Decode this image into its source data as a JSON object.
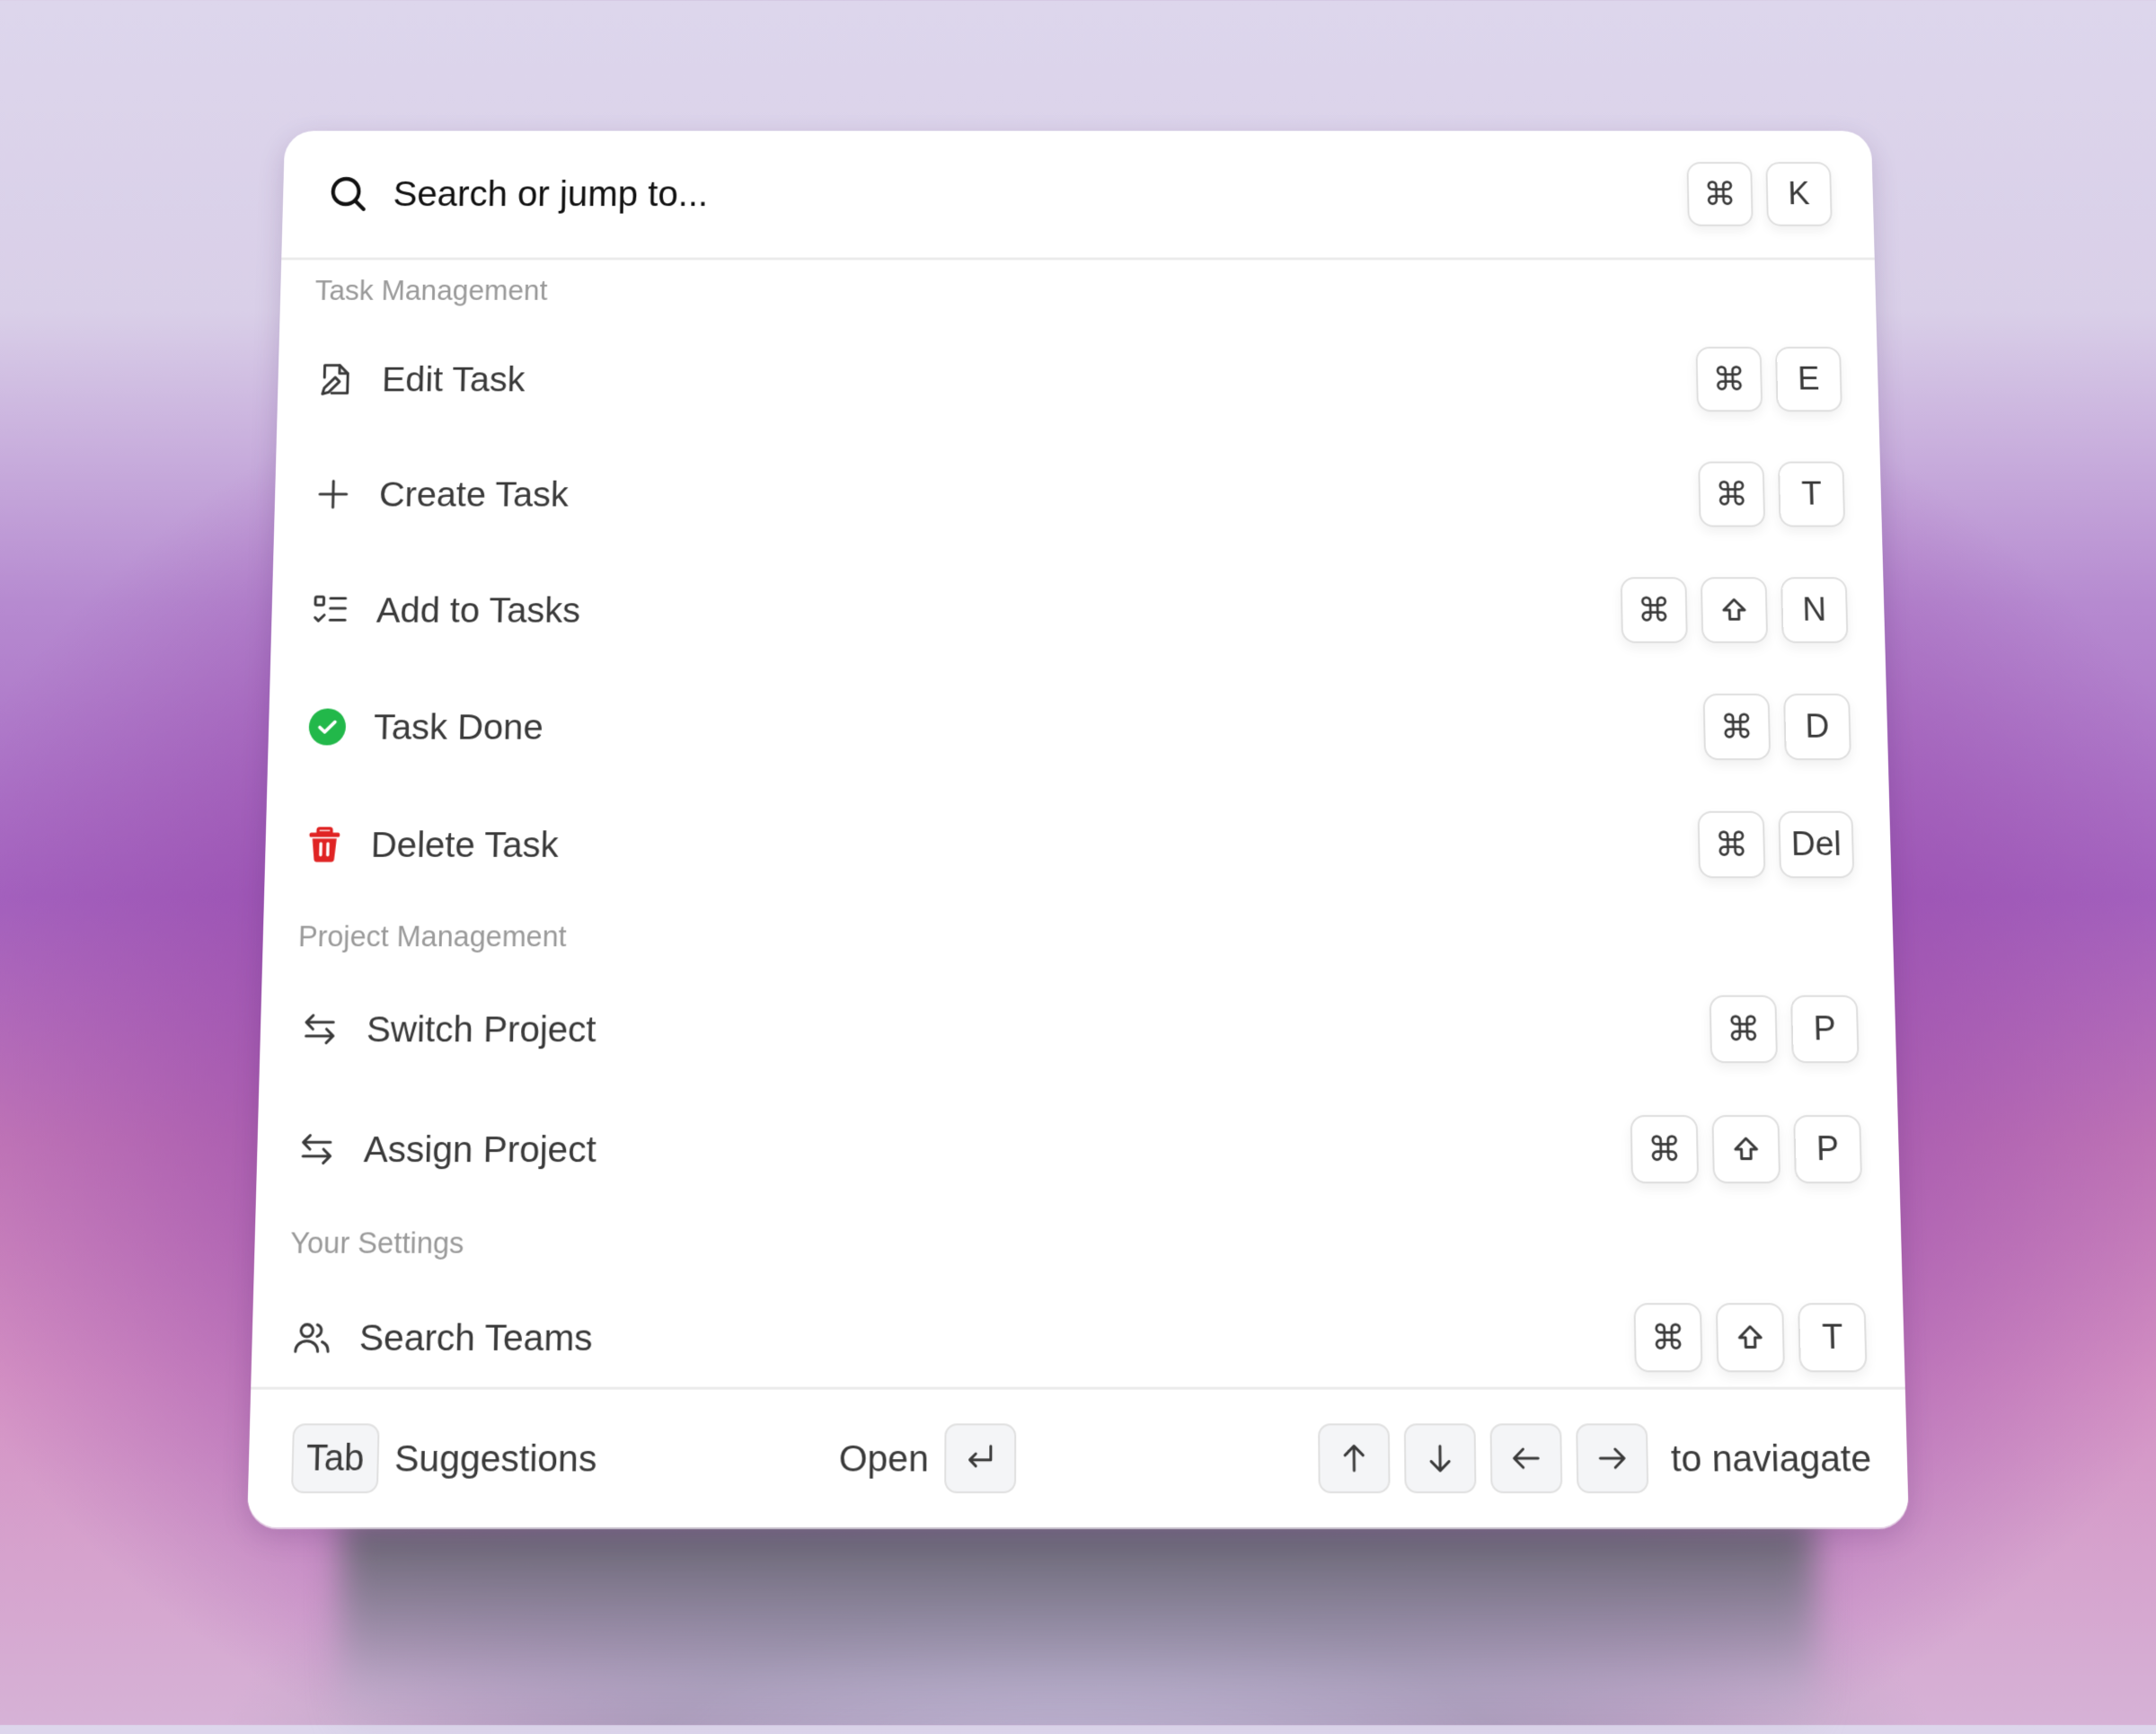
{
  "search": {
    "placeholder": "Search or jump to...",
    "icon": "search-icon",
    "shortcut": [
      "⌘",
      "K"
    ]
  },
  "sections": [
    {
      "label": "Task Management",
      "items": [
        {
          "label": "Edit Task",
          "icon": "file-edit-icon",
          "keys": [
            "⌘",
            "E"
          ]
        },
        {
          "label": "Create Task",
          "icon": "plus-icon",
          "keys": [
            "⌘",
            "T"
          ]
        },
        {
          "label": "Add to Tasks",
          "icon": "checklist-icon",
          "keys": [
            "⌘",
            "⇧",
            "N"
          ]
        },
        {
          "label": "Task Done",
          "icon": "check-circle-icon",
          "keys": [
            "⌘",
            "D"
          ]
        },
        {
          "label": "Delete Task",
          "icon": "trash-icon",
          "keys": [
            "⌘",
            "Del"
          ]
        }
      ]
    },
    {
      "label": "Project Management",
      "items": [
        {
          "label": "Switch Project",
          "icon": "arrows-swap-icon",
          "keys": [
            "⌘",
            "P"
          ]
        },
        {
          "label": "Assign Project",
          "icon": "arrows-swap-icon",
          "keys": [
            "⌘",
            "⇧",
            "P"
          ]
        }
      ]
    },
    {
      "label": "Your Settings",
      "items": [
        {
          "label": "Search Teams",
          "icon": "users-icon",
          "keys": [
            "⌘",
            "⇧",
            "T"
          ]
        }
      ]
    }
  ],
  "footer": {
    "tab_key": "Tab",
    "suggestions_label": "Suggestions",
    "open_label": "Open",
    "enter_key": "↵",
    "nav_keys": [
      "↑",
      "↓",
      "←",
      "→"
    ],
    "navigate_label": "to naviagate"
  },
  "colors": {
    "success": "#22b84a",
    "danger": "#e02424",
    "text": "#3a3a3a",
    "muted": "#9a9a9a"
  }
}
